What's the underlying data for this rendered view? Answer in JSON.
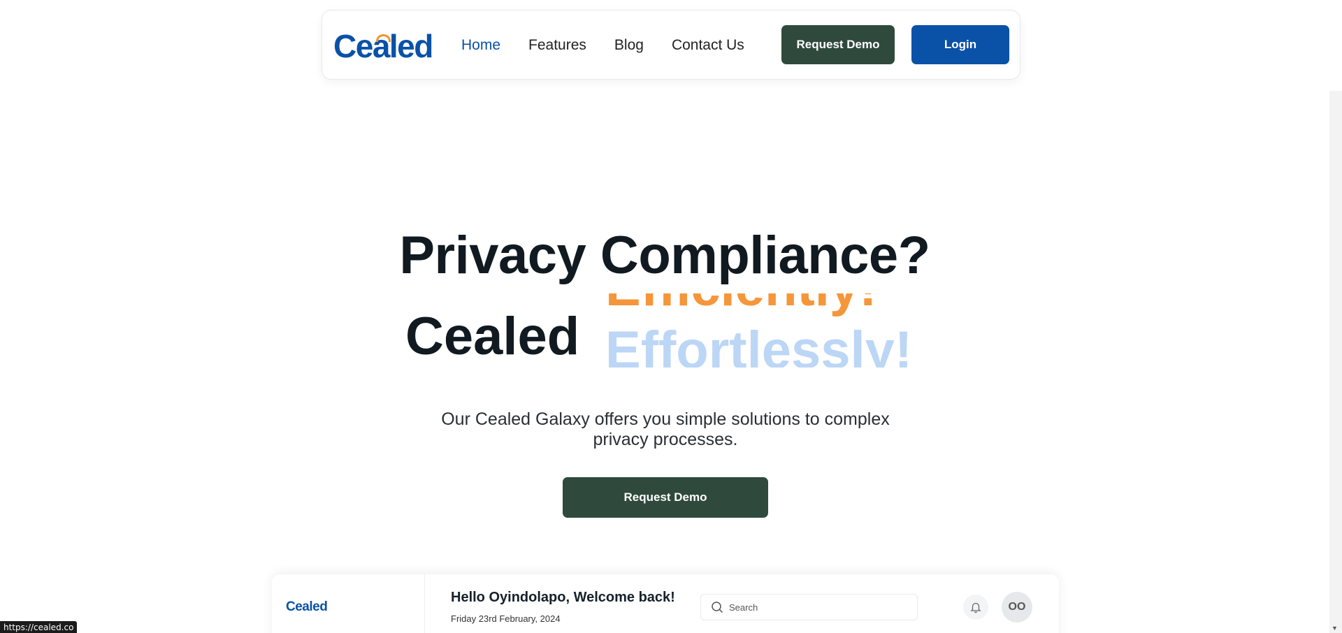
{
  "nav": {
    "logo_pre": "Ce",
    "logo_a": "a",
    "logo_post": "led",
    "links": [
      "Home",
      "Features",
      "Blog",
      "Contact Us"
    ],
    "active": "Home",
    "request_demo": "Request Demo",
    "login": "Login"
  },
  "hero": {
    "title": "Privacy Compliance?",
    "line2_prefix": "Cealed",
    "rotating_previous": "Efficiently!",
    "rotating_current": "Effortlessly!",
    "subtitle": "Our Cealed Galaxy offers you simple solutions to complex privacy processes.",
    "cta": "Request Demo"
  },
  "preview": {
    "logo": "Cealed",
    "greeting": "Hello Oyindolapo, Welcome back!",
    "date": "Friday 23rd February, 2024",
    "search_placeholder": "Search",
    "avatar_initials": "OO"
  },
  "status_url": "https://cealed.co",
  "colors": {
    "brand_blue": "#0a51a8",
    "brand_dark_green": "#2f4a3c",
    "accent_orange": "#f5963a",
    "light_blue": "#bcd6f6"
  }
}
